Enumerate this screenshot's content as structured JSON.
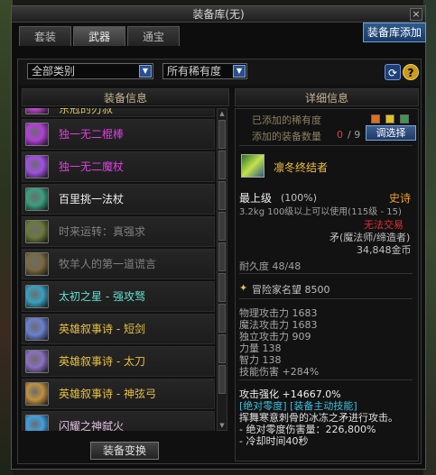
{
  "window": {
    "title": "装备库(无)",
    "close_label": "×",
    "add_button_label": "装备库添加"
  },
  "tabs": [
    {
      "label": "套装",
      "active": false
    },
    {
      "label": "武器",
      "active": true
    },
    {
      "label": "通宝",
      "active": false
    }
  ],
  "filters": {
    "category": "全部类别",
    "rarity": "所有稀有度",
    "refresh_icon": "refresh-icon",
    "help_label": "?"
  },
  "left_panel": {
    "header": "装备信息",
    "items": [
      {
        "name": "东冠的刃叔",
        "color": "#d8c060",
        "icon_color": "#c04cd0"
      },
      {
        "name": "独一无二棍棒",
        "color": "#e040e0",
        "icon_color": "#b040d8"
      },
      {
        "name": "独一无二魔杖",
        "color": "#e040e0",
        "icon_color": "#a050e0"
      },
      {
        "name": "百里挑一法杖",
        "color": "#f0f0f0",
        "icon_color": "#3aa080"
      },
      {
        "name": "时来运转：真强求",
        "color": "#808080",
        "icon_color": "#6a7a3a"
      },
      {
        "name": "牧羊人的第一道谎言",
        "color": "#808080",
        "icon_color": "#7a6a40"
      },
      {
        "name": "太初之星 - 强攻驽",
        "color": "#60e0d0",
        "icon_color": "#3aa0c0"
      },
      {
        "name": "英雄叙事诗 - 短剑",
        "color": "#e8c040",
        "icon_color": "#6a80d0"
      },
      {
        "name": "英雄叙事诗 - 太刀",
        "color": "#e8c040",
        "icon_color": "#8a70c0"
      },
      {
        "name": "英雄叙事诗 - 神弦弓",
        "color": "#e8c040",
        "icon_color": "#c09040"
      },
      {
        "name": "闪耀之神弑火",
        "color": "#e0c0e0",
        "icon_color": "#40a0e0"
      }
    ],
    "convert_button": "装备变换"
  },
  "right_panel": {
    "header": "详细信息",
    "added_rarity_label": "已添加的稀有度",
    "added_count_label": "添加的装备数量",
    "added_count_value": "0",
    "added_count_max": "/ 9",
    "select_button": "调选择",
    "rarity_box_colors": [
      "#e07020",
      "#e0c020",
      "#3a9a4a"
    ],
    "weapon": {
      "name": "凛冬终结者",
      "grade_label": "最上级",
      "grade_percent": "(100%)",
      "rarity": "史诗",
      "weight_level": "3.2kg  100级以上可以使用(115级 - 15)",
      "trade": "无法交易",
      "class_req": "矛(魔法师/缔造者)",
      "price": "34,848金币",
      "durability": "耐久度 48/48",
      "adventure_label": "冒险家名望 8500",
      "stats": [
        "物理攻击力 1683",
        "魔法攻击力 1683",
        "独立攻击力 909",
        "力量 138",
        "智力 138",
        "技能伤害 +284%"
      ],
      "attack_strength": "攻击强化 +14667.0%",
      "skill_header": "[绝对零度] [装备主动技能]",
      "skill_desc": "挥舞寒意刺骨的冰冻之矛进行攻击。",
      "skill_damage": "- 绝对零度伤害量：226,800%",
      "skill_cooldown": "- 冷却时间40秒"
    }
  },
  "colors": {
    "accent_blue": "#2d5a8a",
    "epic_orange": "#e8a030",
    "untradeable_red": "#e03030"
  }
}
